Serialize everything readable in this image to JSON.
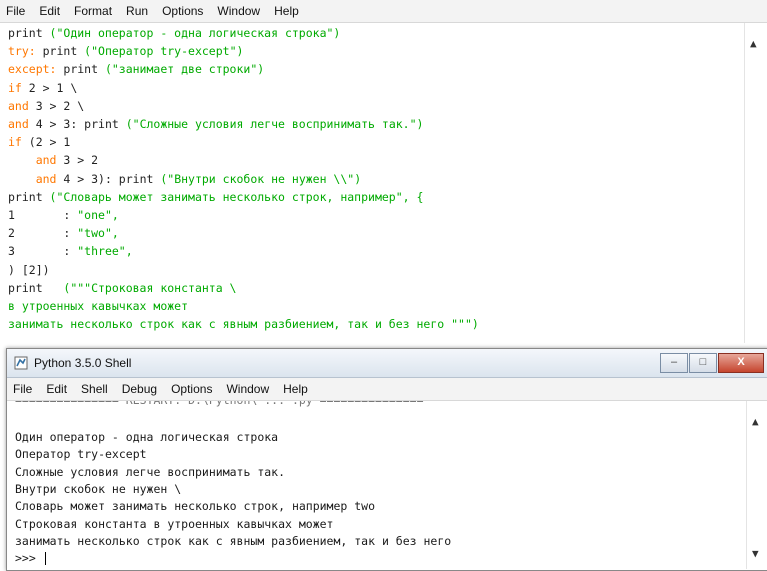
{
  "editor": {
    "menu": [
      "File",
      "Edit",
      "Format",
      "Run",
      "Options",
      "Window",
      "Help"
    ],
    "lines": [
      [
        {
          "c": "n",
          "t": "print "
        },
        {
          "c": "s",
          "t": "(\"Один оператор - одна логическая строка\")"
        }
      ],
      [
        {
          "c": "kw",
          "t": "try: "
        },
        {
          "c": "n",
          "t": "print "
        },
        {
          "c": "s",
          "t": "(\"Оператор try-except\")"
        }
      ],
      [
        {
          "c": "kw",
          "t": "except: "
        },
        {
          "c": "n",
          "t": "print "
        },
        {
          "c": "s",
          "t": "(\"занимает две строки\")"
        }
      ],
      [
        {
          "c": "kw",
          "t": "if "
        },
        {
          "c": "n",
          "t": "2 > 1 \\"
        }
      ],
      [
        {
          "c": "kw",
          "t": "and "
        },
        {
          "c": "n",
          "t": "3 > 2 \\"
        }
      ],
      [
        {
          "c": "kw",
          "t": "and "
        },
        {
          "c": "n",
          "t": "4 > 3: print "
        },
        {
          "c": "s",
          "t": "(\"Сложные условия легче воспринимать так.\")"
        }
      ],
      [
        {
          "c": "kw",
          "t": "if "
        },
        {
          "c": "n",
          "t": "(2 > 1"
        }
      ],
      [
        {
          "c": "n",
          "t": "    "
        },
        {
          "c": "kw",
          "t": "and "
        },
        {
          "c": "n",
          "t": "3 > 2"
        }
      ],
      [
        {
          "c": "n",
          "t": "    "
        },
        {
          "c": "kw",
          "t": "and "
        },
        {
          "c": "n",
          "t": "4 > 3): print "
        },
        {
          "c": "s",
          "t": "(\"Внутри скобок не нужен \\\\\")"
        }
      ],
      [
        {
          "c": "n",
          "t": "print "
        },
        {
          "c": "s",
          "t": "(\"Словарь может занимать несколько строк, например\", {"
        }
      ],
      [
        {
          "c": "n",
          "t": "1       : "
        },
        {
          "c": "s",
          "t": "\"one\","
        }
      ],
      [
        {
          "c": "n",
          "t": "2       : "
        },
        {
          "c": "s",
          "t": "\"two\","
        }
      ],
      [
        {
          "c": "n",
          "t": "3       : "
        },
        {
          "c": "s",
          "t": "\"three\","
        }
      ],
      [
        {
          "c": "n",
          "t": ") [2])"
        }
      ],
      [
        {
          "c": "n",
          "t": "print   "
        },
        {
          "c": "s",
          "t": "(\"\"\"Строковая константа \\"
        }
      ],
      [
        {
          "c": "s",
          "t": "в утроенных кавычках может"
        }
      ],
      [
        {
          "c": "s",
          "t": "занимать несколько строк как с явным разбиением, так и без него \"\"\")"
        }
      ]
    ]
  },
  "shell": {
    "title": "Python 3.5.0 Shell",
    "buttons": {
      "minimize": "–",
      "maximize": "□",
      "close": "X"
    },
    "menu": [
      "File",
      "Edit",
      "Shell",
      "Debug",
      "Options",
      "Window",
      "Help"
    ],
    "cut_line": "=============== RESTART: D:\\Python\\ ... .py ===============",
    "output": [
      "Один оператор - одна логическая строка",
      "Оператор try-except",
      "Сложные условия легче воспринимать так.",
      "Внутри скобок не нужен \\",
      "Словарь может занимать несколько строк, например two",
      "Строковая константа в утроенных кавычках может",
      "занимать несколько строк как с явным разбиением, так и без него"
    ],
    "prompt": ">>> "
  }
}
